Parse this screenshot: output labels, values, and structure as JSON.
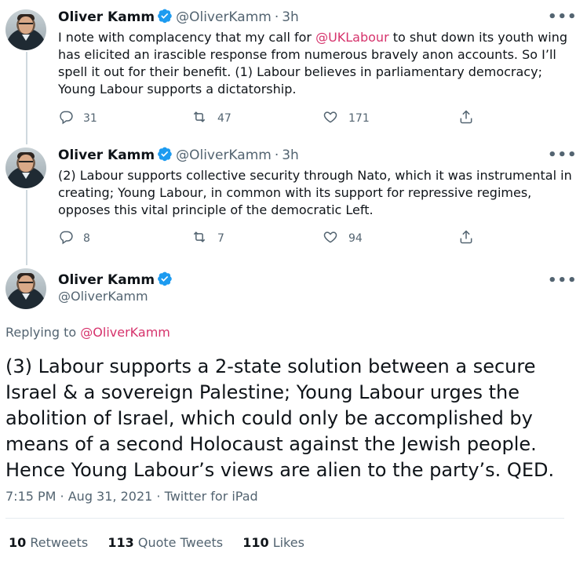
{
  "tweets": [
    {
      "name": "Oliver Kamm",
      "handle": "@OliverKamm",
      "time": "3h",
      "text_before": "I note with complacency that my call for ",
      "mention": "@UKLabour",
      "text_after": " to shut down its youth wing has elicited an irascible response from numerous bravely anon accounts. So I’ll spell it out for their benefit. (1) Labour believes in parliamentary democracy; Young Labour supports a dictatorship.",
      "replies": "31",
      "retweets": "47",
      "likes": "171"
    },
    {
      "name": "Oliver Kamm",
      "handle": "@OliverKamm",
      "time": "3h",
      "text": "(2) Labour supports collective security through Nato, which it was instrumental in creating; Young Labour, in common with its support for repressive regimes, opposes this vital principle of the democratic Left.",
      "replies": "8",
      "retweets": "7",
      "likes": "94"
    }
  ],
  "main": {
    "name": "Oliver Kamm",
    "handle": "@OliverKamm",
    "replying_label": "Replying to ",
    "replying_to": "@OliverKamm",
    "text": "(3) Labour supports a 2-state solution between a secure Israel & a sovereign Palestine; Young Labour urges the abolition of Israel, which could only be accomplished by means of a second Holocaust against the Jewish people. Hence Young Labour’s views are alien to the party’s. QED.",
    "meta": "7:15 PM · Aug 31, 2021 · Twitter for iPad",
    "retweets_count": "10",
    "retweets_label": "Retweets",
    "quote_count": "113",
    "quote_label": "Quote Tweets",
    "likes_count": "110",
    "likes_label": "Likes"
  },
  "separator": "·",
  "more_glyph": "•••",
  "icons": [
    "verified-badge-icon",
    "reply-icon",
    "retweet-icon",
    "like-icon",
    "share-icon",
    "more-icon"
  ],
  "colors": {
    "mention": "#d6336c",
    "verified": "#1d9bf0",
    "muted": "#536471"
  }
}
